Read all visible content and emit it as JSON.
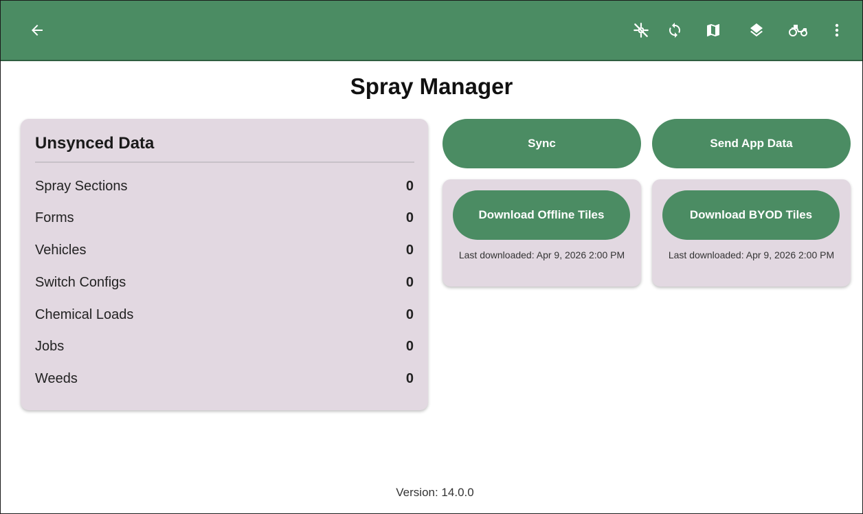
{
  "appbar": {
    "color": "#4b8c63",
    "back_icon": "arrow-left-icon",
    "actions": [
      {
        "icon": "gps-off-icon"
      },
      {
        "icon": "sync-icon"
      },
      {
        "icon": "map-icon"
      },
      {
        "icon": "layers-icon"
      },
      {
        "icon": "vehicle-icon"
      },
      {
        "icon": "more-vert-icon"
      }
    ]
  },
  "page": {
    "title": "Spray Manager"
  },
  "unsynced": {
    "heading": "Unsynced Data",
    "rows": [
      {
        "label": "Spray Sections",
        "count": "0"
      },
      {
        "label": "Forms",
        "count": "0"
      },
      {
        "label": "Vehicles",
        "count": "0"
      },
      {
        "label": "Switch Configs",
        "count": "0"
      },
      {
        "label": "Chemical Loads",
        "count": "0"
      },
      {
        "label": "Jobs",
        "count": "0"
      },
      {
        "label": "Weeds",
        "count": "0"
      }
    ]
  },
  "actions": {
    "sync_label": "Sync",
    "send_app_data_label": "Send App Data"
  },
  "tiles": {
    "offline": {
      "button_label": "Download Offline Tiles",
      "last_downloaded": "Last downloaded: Apr 9, 2026 2:00 PM"
    },
    "byod": {
      "button_label": "Download BYOD Tiles",
      "last_downloaded": "Last downloaded: Apr 9, 2026 2:00 PM"
    }
  },
  "footer": {
    "version": "Version: 14.0.0"
  }
}
